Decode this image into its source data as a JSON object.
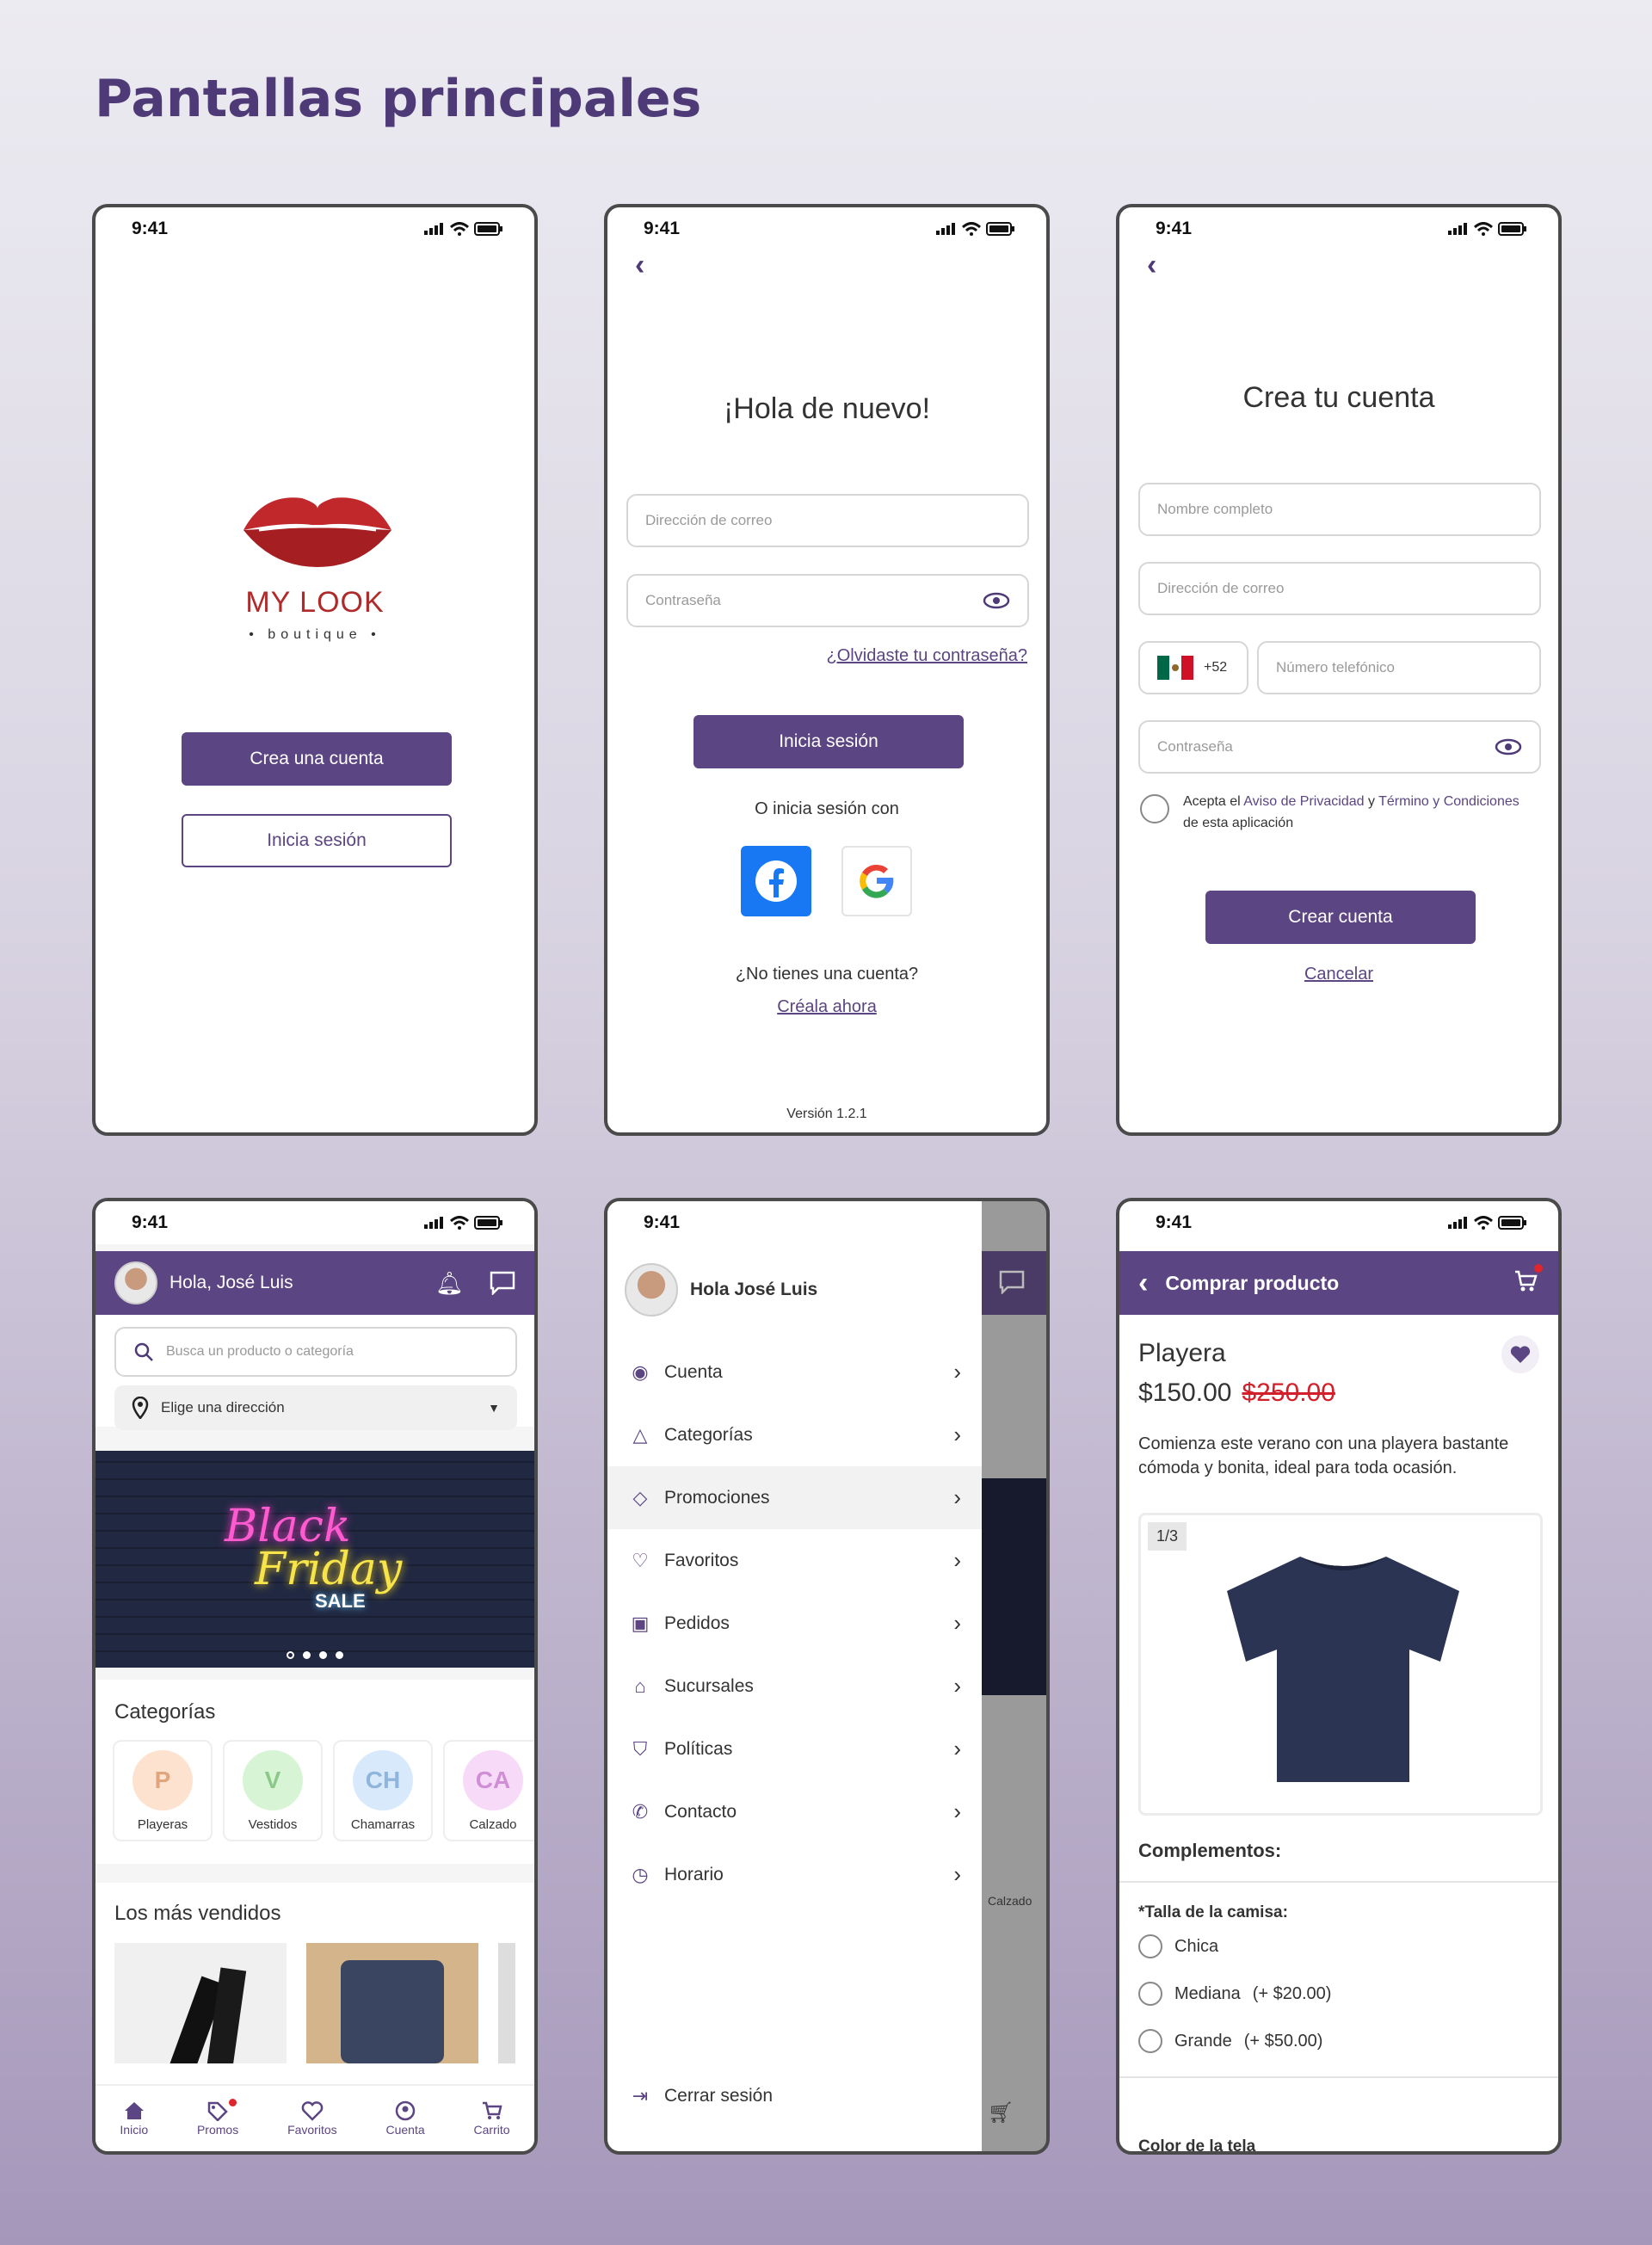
{
  "page_title": "Pantallas principales",
  "status_time": "9:41",
  "splash": {
    "brand": "MY LOOK",
    "brand_sub": "• boutique •",
    "create_btn": "Crea una cuenta",
    "login_btn": "Inicia sesión",
    "brand_color": "#b02a2a"
  },
  "login": {
    "title": "¡Hola de nuevo!",
    "email_ph": "Dirección de correo",
    "password_ph": "Contraseña",
    "forgot": "¿Olvidaste tu contraseña?",
    "login_btn": "Inicia sesión",
    "or_text": "O inicia sesión con",
    "no_account": "¿No tienes una cuenta?",
    "create_now": "Créala ahora",
    "version": "Versión 1.2.1"
  },
  "register": {
    "title": "Crea tu cuenta",
    "name_ph": "Nombre completo",
    "email_ph": "Dirección de correo",
    "country_code": "+52",
    "phone_ph": "Número telefónico",
    "password_ph": "Contraseña",
    "accept_pre": "Acepta el ",
    "privacy": "Aviso de Privacidad",
    "and": " y ",
    "terms": "Término y Condiciones",
    "accept_post": "de esta aplicación",
    "create_btn": "Crear cuenta",
    "cancel": "Cancelar"
  },
  "home": {
    "greeting": "Hola, José Luis",
    "search_ph": "Busca un producto o categoría",
    "address": "Elige una dirección",
    "banner_line1": "Black",
    "banner_line2": "Friday",
    "banner_line3": "SALE",
    "categories_title": "Categorías",
    "categories": [
      {
        "initial": "P",
        "label": "Playeras",
        "bg": "#fde2cf",
        "fg": "#e0a57d"
      },
      {
        "initial": "V",
        "label": "Vestidos",
        "bg": "#d7f5d4",
        "fg": "#8cc88a"
      },
      {
        "initial": "CH",
        "label": "Chamarras",
        "bg": "#d7e9fb",
        "fg": "#8fb5dc"
      },
      {
        "initial": "CA",
        "label": "Calzado",
        "bg": "#f7d9f8",
        "fg": "#d08fd5"
      }
    ],
    "bestsellers_title": "Los más vendidos",
    "nav": [
      {
        "icon": "home-icon",
        "label": "Inicio"
      },
      {
        "icon": "tag-icon",
        "label": "Promos"
      },
      {
        "icon": "heart-icon",
        "label": "Favoritos"
      },
      {
        "icon": "user-icon",
        "label": "Cuenta"
      },
      {
        "icon": "cart-icon",
        "label": "Carrito"
      }
    ]
  },
  "drawer": {
    "user": "Hola José Luis",
    "items": [
      {
        "icon": "user-icon",
        "label": "Cuenta"
      },
      {
        "icon": "shapes-icon",
        "label": "Categorías"
      },
      {
        "icon": "tag-icon",
        "label": "Promociones"
      },
      {
        "icon": "heart-icon",
        "label": "Favoritos"
      },
      {
        "icon": "bag-icon",
        "label": "Pedidos"
      },
      {
        "icon": "store-icon",
        "label": "Sucursales"
      },
      {
        "icon": "shield-icon",
        "label": "Políticas"
      },
      {
        "icon": "phone-icon",
        "label": "Contacto"
      },
      {
        "icon": "clock-icon",
        "label": "Horario"
      }
    ],
    "logout": "Cerrar sesión",
    "bg_label": "Calzado"
  },
  "product": {
    "header": "Comprar producto",
    "name": "Playera",
    "price": "$150.00",
    "old_price": "$250.00",
    "description": "Comienza este verano con una playera bastante cómoda y bonita, ideal para toda ocasión.",
    "counter": "1/3",
    "complements": "Complementos:",
    "size_label": "*Talla de la camisa:",
    "sizes": [
      {
        "label": "Chica",
        "extra": ""
      },
      {
        "label": "Mediana",
        "extra": "(+ $20.00)"
      },
      {
        "label": "Grande",
        "extra": "(+ $50.00)"
      }
    ],
    "color_label": "Color de la tela"
  }
}
